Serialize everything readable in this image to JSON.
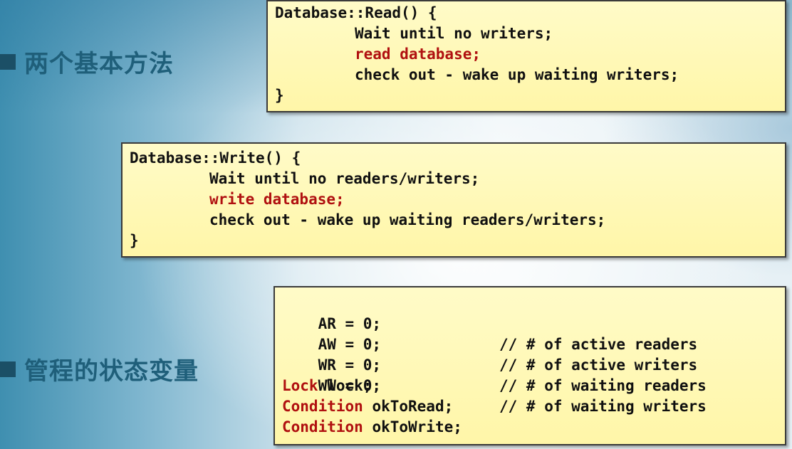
{
  "headings": {
    "methods": "两个基本方法",
    "state_vars": "管程的状态变量"
  },
  "read_box": {
    "signature": "Database::Read() {",
    "wait": "Wait until no writers;",
    "action": "read database;",
    "checkout": "check out - wake up waiting writers;",
    "close": "}"
  },
  "write_box": {
    "signature": "Database::Write() {",
    "wait": "Wait until no readers/writers;",
    "action": "write database;",
    "checkout": "check out - wake up waiting readers/writers;",
    "close": "}"
  },
  "vars_box": {
    "counters": [
      {
        "code": "AR = 0;",
        "comment": "// # of active readers"
      },
      {
        "code": "AW = 0;",
        "comment": "// # of active writers"
      },
      {
        "code": "WR = 0;",
        "comment": "// # of waiting readers"
      },
      {
        "code": "WW = 0;",
        "comment": "// # of waiting writers"
      }
    ],
    "lock": {
      "type": "Lock",
      "name": "lock;"
    },
    "conditions": [
      {
        "type": "Condition",
        "name": "okToRead;"
      },
      {
        "type": "Condition",
        "name": "okToWrite;"
      }
    ]
  },
  "colors": {
    "heading": "#1f5f7a",
    "bullet": "#1b4f66",
    "code_box_bg": "#fff6a8",
    "highlight": "#b01010"
  }
}
